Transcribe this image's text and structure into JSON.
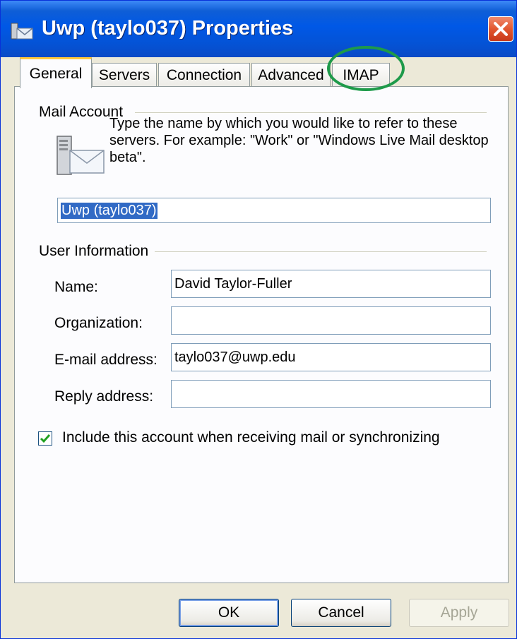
{
  "window": {
    "title": "Uwp (taylo037) Properties",
    "close_glyph": "✕"
  },
  "tabs": [
    {
      "label": "General",
      "active": true
    },
    {
      "label": "Servers",
      "active": false
    },
    {
      "label": "Connection",
      "active": false
    },
    {
      "label": "Advanced",
      "active": false
    },
    {
      "label": "IMAP",
      "active": false,
      "highlighted": true
    }
  ],
  "mail_account": {
    "group_label": "Mail Account",
    "icon": "mail-server-icon",
    "description": "Type the name by which you would like to refer to these servers.  For example: \"Work\" or \"Windows Live Mail desktop beta\".",
    "account_name_value": "Uwp (taylo037)"
  },
  "user_information": {
    "group_label": "User Information",
    "fields": [
      {
        "label": "Name:",
        "value": "David Taylor-Fuller"
      },
      {
        "label": "Organization:",
        "value": ""
      },
      {
        "label": "E-mail address:",
        "value": "taylo037@uwp.edu"
      },
      {
        "label": "Reply address:",
        "value": ""
      }
    ]
  },
  "include_account": {
    "checked": true,
    "label": "Include this account when receiving mail or synchronizing"
  },
  "buttons": {
    "ok": "OK",
    "cancel": "Cancel",
    "apply": "Apply"
  },
  "colors": {
    "titlebar": "#0058e6",
    "highlight_circle": "#1e9a4a",
    "selection": "#316ac5"
  }
}
